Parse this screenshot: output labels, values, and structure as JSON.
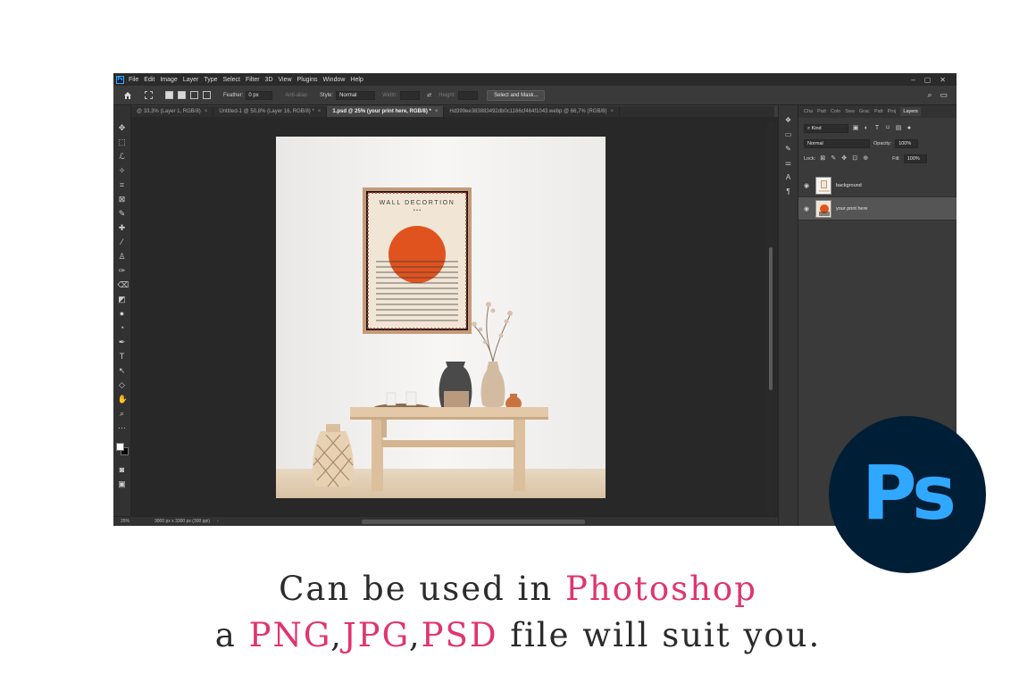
{
  "app": {
    "logo": "Ps",
    "menu": [
      "File",
      "Edit",
      "Image",
      "Layer",
      "Type",
      "Select",
      "Filter",
      "3D",
      "View",
      "Plugins",
      "Window",
      "Help"
    ],
    "window_controls": [
      "–",
      "▢",
      "✕"
    ]
  },
  "options": {
    "feather_label": "Feather:",
    "feather_value": "0 px",
    "anti_alias_label": "Anti-alias",
    "style_label": "Style:",
    "style_value": "Normal",
    "width_label": "Width:",
    "height_label": "Height:",
    "select_mask_label": "Select and Mask..."
  },
  "tabs": [
    {
      "label": "@ 33,3% (Layer 1, RGB/8)",
      "active": false
    },
    {
      "label": "Untitled-1 @ 50,8% (Layer 16, RGB/8) *",
      "active": false
    },
    {
      "label": "1.psd @ 25% (your print here, RGB/8) *",
      "active": true
    },
    {
      "label": "Hd399ee383883492db0c1166cf464f1043.webp @ 66,7% (RGB/8)",
      "active": false
    }
  ],
  "tab_close": "×",
  "tools": [
    "✥",
    "⬚",
    "ℒ",
    "✧",
    "⌗",
    "⊠",
    "✎",
    "✚",
    "⁄",
    "♙",
    "✑",
    "⌫",
    "◩",
    "●",
    "◔",
    "✒",
    "T",
    "↖",
    "◇",
    "✋",
    "⌕",
    "⋯"
  ],
  "canvas": {
    "poster_title": "WALL DECORTION",
    "poster_dots": "• • •",
    "wall_color": "#f4f3f1",
    "sun_color": "#e0531f",
    "frame_color": "#c49a78",
    "poster_bg": "#f1e6d6"
  },
  "status": {
    "zoom": "25%",
    "doc_info": "3000 px x 3300 px (300 ppi)",
    "chevron": "›"
  },
  "mini_icons": [
    "❖",
    "▭",
    "✎",
    "⚌",
    "A",
    "¶"
  ],
  "layers_panel": {
    "tabs": [
      "Cha",
      "Patt",
      "Colo",
      "Swa",
      "Grac",
      "Patt",
      "Proj",
      "Layers"
    ],
    "filter_label": "Kind",
    "blend_mode": "Normal",
    "opacity_label": "Opacity:",
    "opacity_value": "100%",
    "lock_label": "Lock:",
    "fill_label": "Fill:",
    "fill_value": "100%",
    "layers": [
      {
        "name": "background",
        "visible": true,
        "selected": false
      },
      {
        "name": "your print here",
        "visible": true,
        "selected": true
      }
    ]
  },
  "badge": {
    "text": "Ps",
    "bg": "#001e36",
    "fg": "#31a8ff"
  },
  "caption": {
    "line1_a": "Can be used in ",
    "line1_b": "Photoshop",
    "line2_a": "a ",
    "line2_png": "PNG",
    "line2_comma1": ",",
    "line2_jpg": "JPG",
    "line2_comma2": ",",
    "line2_psd": "PSD",
    "line2_b": " file will suit you.",
    "highlight_color": "#e0356f"
  }
}
